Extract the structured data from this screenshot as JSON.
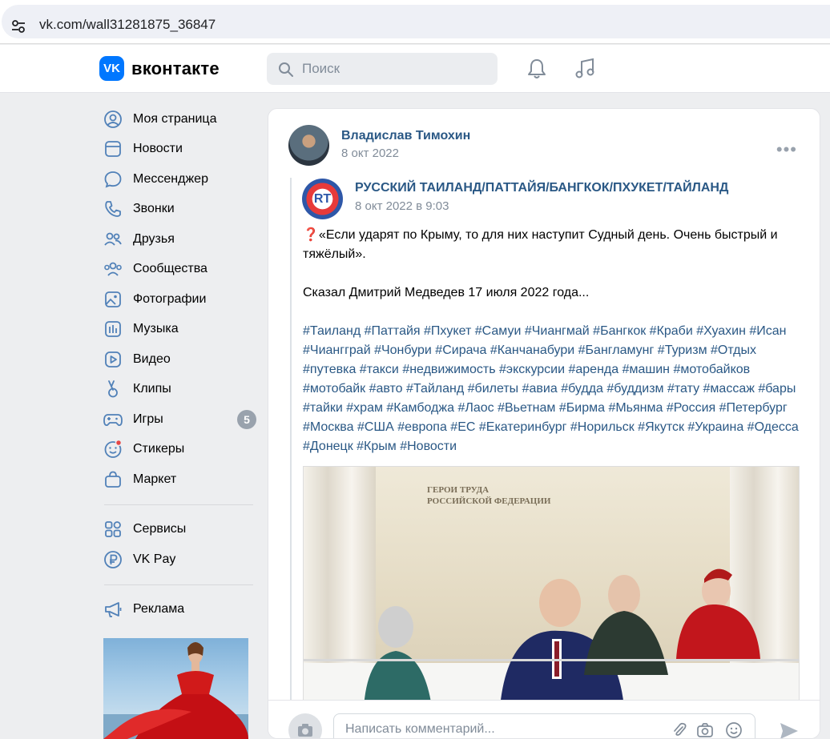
{
  "browser": {
    "url": "vk.com/wall31281875_36847"
  },
  "header": {
    "logo_mark": "VK",
    "logo_text": "вконтакте",
    "search_placeholder": "Поиск"
  },
  "sidebar": {
    "items": [
      {
        "label": "Моя страница",
        "icon": "user-circle-icon"
      },
      {
        "label": "Новости",
        "icon": "news-icon"
      },
      {
        "label": "Мессенджер",
        "icon": "message-icon"
      },
      {
        "label": "Звонки",
        "icon": "phone-icon"
      },
      {
        "label": "Друзья",
        "icon": "friends-icon"
      },
      {
        "label": "Сообщества",
        "icon": "communities-icon"
      },
      {
        "label": "Фотографии",
        "icon": "photo-icon"
      },
      {
        "label": "Музыка",
        "icon": "music-icon"
      },
      {
        "label": "Видео",
        "icon": "video-icon"
      },
      {
        "label": "Клипы",
        "icon": "clips-icon"
      },
      {
        "label": "Игры",
        "icon": "gamepad-icon",
        "badge": "5"
      },
      {
        "label": "Стикеры",
        "icon": "smile-icon"
      },
      {
        "label": "Маркет",
        "icon": "bag-icon"
      }
    ],
    "services": [
      {
        "label": "Сервисы",
        "icon": "grid-icon"
      },
      {
        "label": "VK Pay",
        "icon": "ruble-icon"
      }
    ],
    "ads": [
      {
        "label": "Реклама",
        "icon": "megaphone-icon"
      }
    ]
  },
  "post": {
    "author": "Владислав Тимохин",
    "date": "8 окт 2022",
    "repost": {
      "group": "РУССКИЙ ТАИЛАНД/ПАТТАЙЯ/БАНГКОК/ПХУКЕТ/ТАЙЛАНД",
      "avatar_text": "RT",
      "date": "8 окт 2022 в 9:03"
    },
    "text_1": "❓«Если ударят по Крыму, то для них наступит Судный день. Очень быстрый и тяжёлый».",
    "text_2": "Сказал Дмитрий Медведев 17 июля 2022 года...",
    "hashtags": "#Таиланд #Паттайя #Пхукет #Самуи #Чиангмай #Бангкок #Краби #Хуахин #Исан #Чиангграй #Чонбури #Сирача #Канчанабури #Бангламунг #Туризм #Отдых #путевка #такси #недвижимость #экскурсии #аренда #машин #мотобайков #мотобайк #авто #Тайланд #билеты #авиа #будда #буддизм #тату #массаж #бары #тайки #храм #Камбоджа #Лаос #Вьетнам #Бирма #Мьянма #Россия #Петербург #Москва #США #европа #ЕС #Екатеринбург #Норильск #Якутск #Украина #Одесса #Донецк #Крым #Новости",
    "photo_sign": "ГЕРОИ ТРУДА\nРОССИЙСКОЙ ФЕДЕРАЦИИ"
  },
  "comment": {
    "placeholder": "Написать комментарий..."
  },
  "colors": {
    "accent": "#0077ff",
    "link": "#2a5885",
    "bg": "#edeef0"
  }
}
